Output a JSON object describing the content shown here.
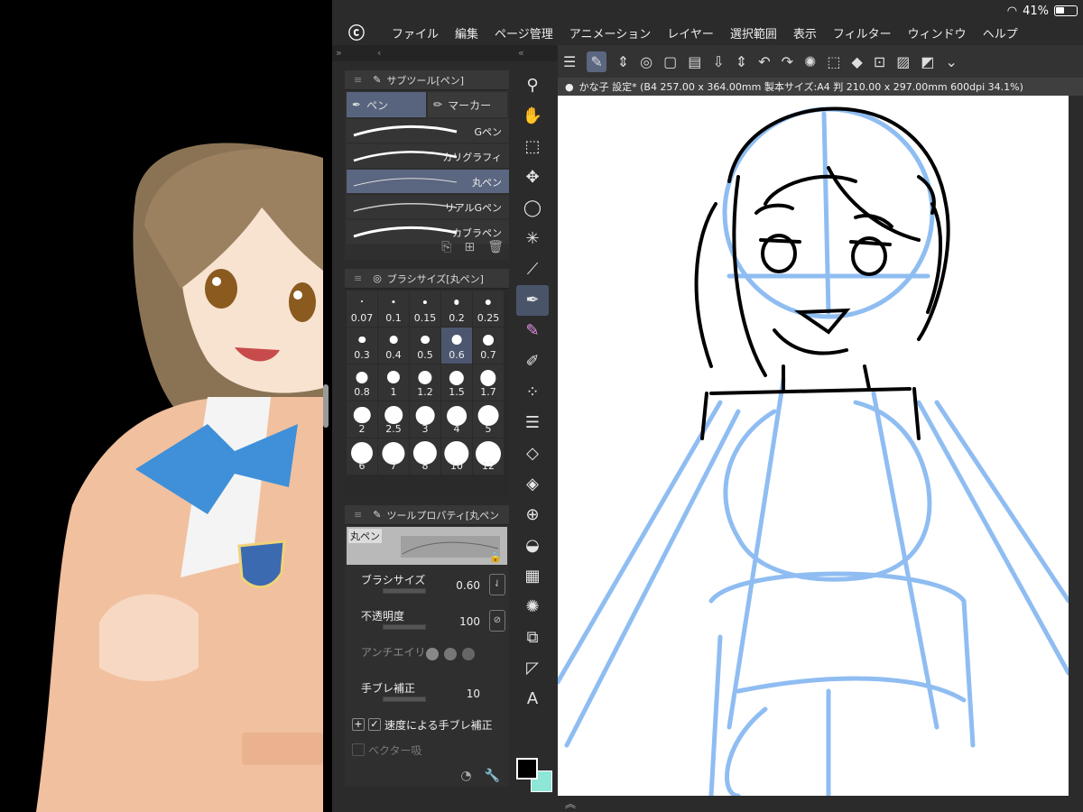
{
  "status": {
    "battery": "41%"
  },
  "menu": [
    "ファイル",
    "編集",
    "ページ管理",
    "アニメーション",
    "レイヤー",
    "選択範囲",
    "表示",
    "フィルター",
    "ウィンドウ",
    "ヘルプ"
  ],
  "subtool": {
    "title": "サブツール[ペン]",
    "tabs": [
      "ペン",
      "マーカー"
    ],
    "brushes": [
      "Gペン",
      "カリグラフィ",
      "丸ペン",
      "リアルGペン",
      "カブラペン"
    ],
    "selected_brush": "丸ペン"
  },
  "brush_size": {
    "title": "ブラシサイズ[丸ペン]",
    "sizes": [
      "0.07",
      "0.1",
      "0.15",
      "0.2",
      "0.25",
      "0.3",
      "0.4",
      "0.5",
      "0.6",
      "0.7",
      "0.8",
      "1",
      "1.2",
      "1.5",
      "1.7",
      "2",
      "2.5",
      "3",
      "4",
      "5",
      "6",
      "7",
      "8",
      "10",
      "12"
    ],
    "selected": "0.6"
  },
  "tool_property": {
    "title": "ツールプロパティ[丸ペン",
    "preview_label": "丸ペン",
    "brush_size_label": "ブラシサイズ",
    "brush_size_value": "0.60",
    "opacity_label": "不透明度",
    "opacity_value": "100",
    "antialias_label": "アンチエイリ",
    "stabilization_label": "手ブレ補正",
    "stabilization_value": "10",
    "speed_stabilization_label": "速度による手ブレ補正",
    "vector_label": "ベクター吸"
  },
  "canvas": {
    "tab_title": "かな子  設定* (B4 257.00 x 364.00mm 製本サイズ:A4 判 210.00 x 297.00mm 600dpi 34.1%)"
  },
  "colors": {
    "main_color": "#000000",
    "sub_color": "#8ee6d6",
    "accent": "#5b6680"
  }
}
